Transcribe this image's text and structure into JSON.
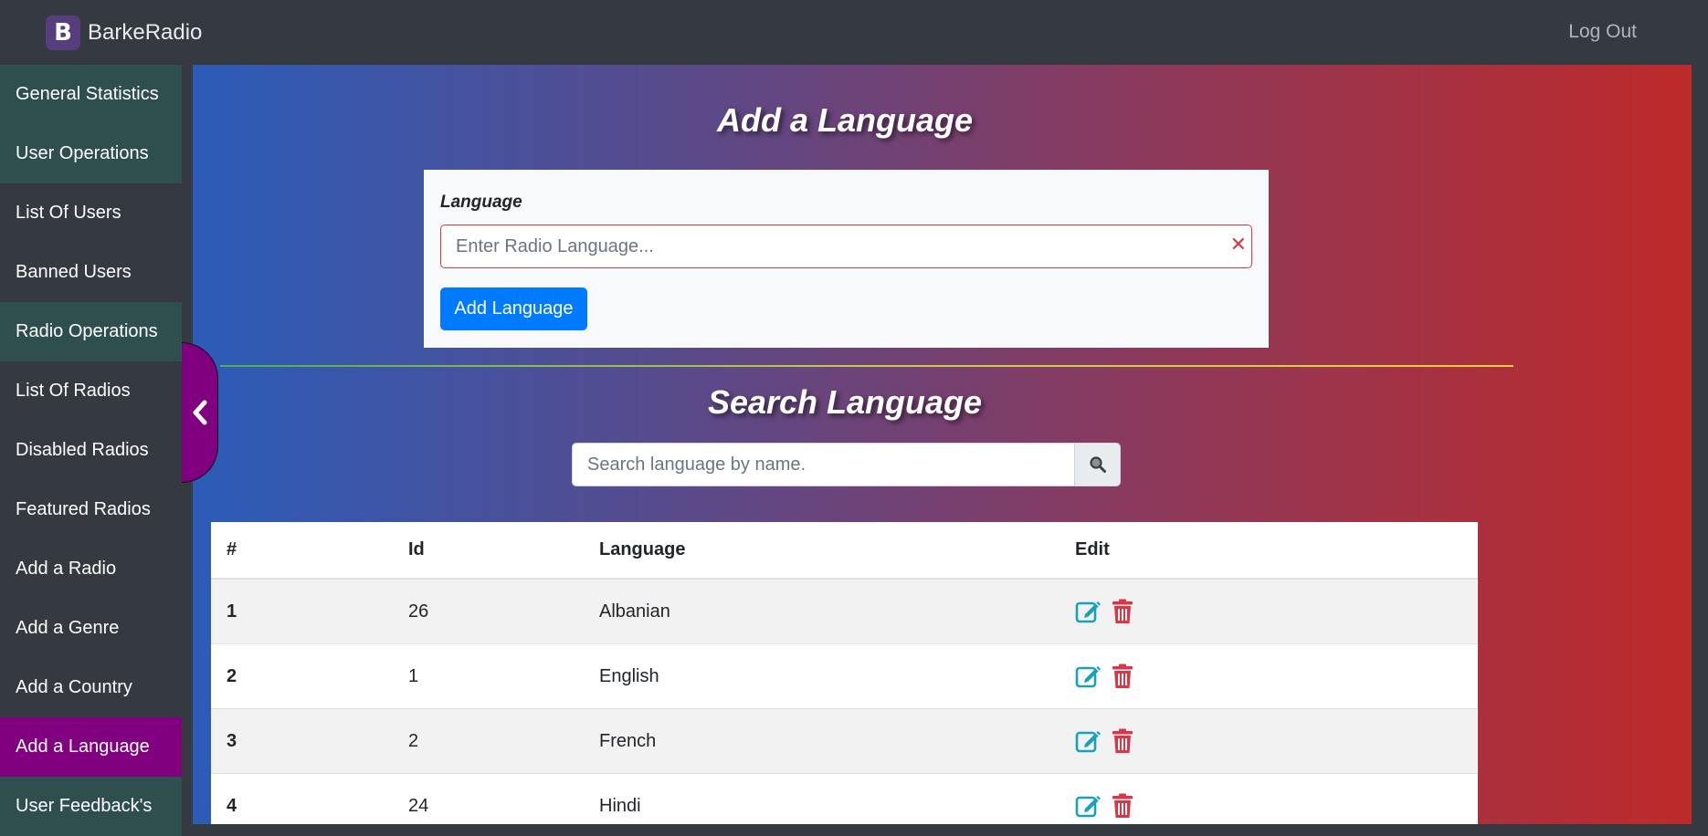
{
  "header": {
    "brand_logo": "B",
    "brand_name": "BarkeRadio",
    "logout_label": "Log Out"
  },
  "sidebar": {
    "items": [
      {
        "label": "General Statistics",
        "kind": "section"
      },
      {
        "label": "User Operations",
        "kind": "section"
      },
      {
        "label": "List Of Users",
        "kind": "link"
      },
      {
        "label": "Banned Users",
        "kind": "link"
      },
      {
        "label": "Radio Operations",
        "kind": "section"
      },
      {
        "label": "List Of Radios",
        "kind": "link"
      },
      {
        "label": "Disabled Radios",
        "kind": "link"
      },
      {
        "label": "Featured Radios",
        "kind": "link"
      },
      {
        "label": "Add a Radio",
        "kind": "link"
      },
      {
        "label": "Add a Genre",
        "kind": "link"
      },
      {
        "label": "Add a Country",
        "kind": "link"
      },
      {
        "label": "Add a Language",
        "kind": "active"
      },
      {
        "label": "User Feedback's",
        "kind": "section"
      }
    ],
    "toggle_icon": "chevron-left-icon"
  },
  "add_form": {
    "title": "Add a Language",
    "field_label": "Language",
    "placeholder": "Enter Radio Language...",
    "value": "",
    "clear_icon": "close-icon",
    "submit_label": "Add Language"
  },
  "search": {
    "title": "Search Language",
    "placeholder": "Search language by name.",
    "value": "",
    "button_icon": "search-icon"
  },
  "table": {
    "headers": [
      "#",
      "Id",
      "Language",
      "Edit"
    ],
    "rows": [
      {
        "num": "1",
        "id": "26",
        "language": "Albanian"
      },
      {
        "num": "2",
        "id": "1",
        "language": "English"
      },
      {
        "num": "3",
        "id": "2",
        "language": "French"
      },
      {
        "num": "4",
        "id": "24",
        "language": "Hindi"
      }
    ],
    "edit_icon": "edit-icon",
    "delete_icon": "trash-icon"
  },
  "colors": {
    "topbar": "#343a40",
    "sidebar_section": "#2f4f4f",
    "sidebar_active": "#800080",
    "primary_button": "#007bff",
    "edit_icon": "#17a2b8",
    "delete_icon": "#dc3545"
  }
}
